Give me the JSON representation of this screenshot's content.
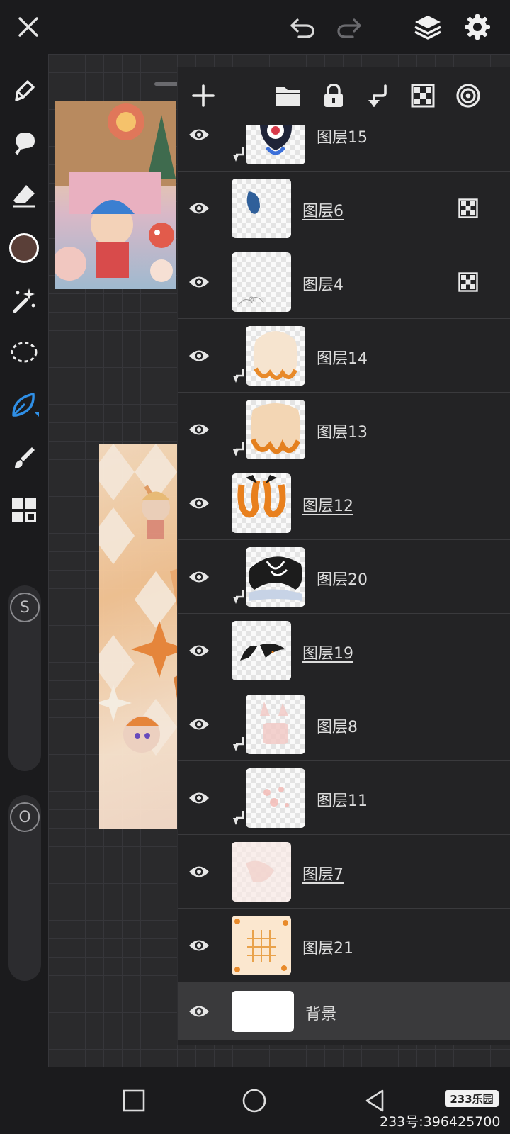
{
  "colors": {
    "accent": "#2f8fe6",
    "current_brush_color": "#5a3f38",
    "panel_bg": "#232325",
    "selected_row_bg": "#3a3a3c"
  },
  "topbar": {
    "icons": [
      "close-icon",
      "undo-icon",
      "redo-icon",
      "layers-icon",
      "settings-icon"
    ]
  },
  "toolbar": {
    "tools": [
      "brush-icon",
      "smudge-icon",
      "eraser-icon",
      "color-swatch",
      "magic-wand-icon",
      "lasso-icon",
      "leaf-brush-icon",
      "fill-brush-icon",
      "grid-icon"
    ],
    "size_slider_label": "S",
    "opacity_slider_label": "O"
  },
  "layer_panel": {
    "toolbar_icons": [
      "add-layer-icon",
      "folder-icon",
      "lock-icon",
      "clip-icon",
      "alpha-lock-icon",
      "blend-icon"
    ],
    "layers": [
      {
        "name": "图层15",
        "clipped": true,
        "underlined": false,
        "alpha_locked": false
      },
      {
        "name": "图层6",
        "clipped": false,
        "underlined": true,
        "alpha_locked": true
      },
      {
        "name": "图层4",
        "clipped": false,
        "underlined": false,
        "alpha_locked": true
      },
      {
        "name": "图层14",
        "clipped": true,
        "underlined": false,
        "alpha_locked": false
      },
      {
        "name": "图层13",
        "clipped": true,
        "underlined": false,
        "alpha_locked": false
      },
      {
        "name": "图层12",
        "clipped": false,
        "underlined": true,
        "alpha_locked": false
      },
      {
        "name": "图层20",
        "clipped": true,
        "underlined": false,
        "alpha_locked": false
      },
      {
        "name": "图层19",
        "clipped": false,
        "underlined": true,
        "alpha_locked": false
      },
      {
        "name": "图层8",
        "clipped": true,
        "underlined": false,
        "alpha_locked": false
      },
      {
        "name": "图层11",
        "clipped": true,
        "underlined": false,
        "alpha_locked": false
      },
      {
        "name": "图层7",
        "clipped": false,
        "underlined": true,
        "alpha_locked": false
      },
      {
        "name": "图层21",
        "clipped": false,
        "underlined": false,
        "alpha_locked": false
      },
      {
        "name": "背景",
        "clipped": false,
        "underlined": false,
        "alpha_locked": false,
        "selected": true
      }
    ]
  },
  "navbar": {
    "icons": [
      "recents-icon",
      "home-icon",
      "back-icon"
    ]
  },
  "watermark": {
    "badge": "233乐园",
    "text": "233号:396425700"
  }
}
